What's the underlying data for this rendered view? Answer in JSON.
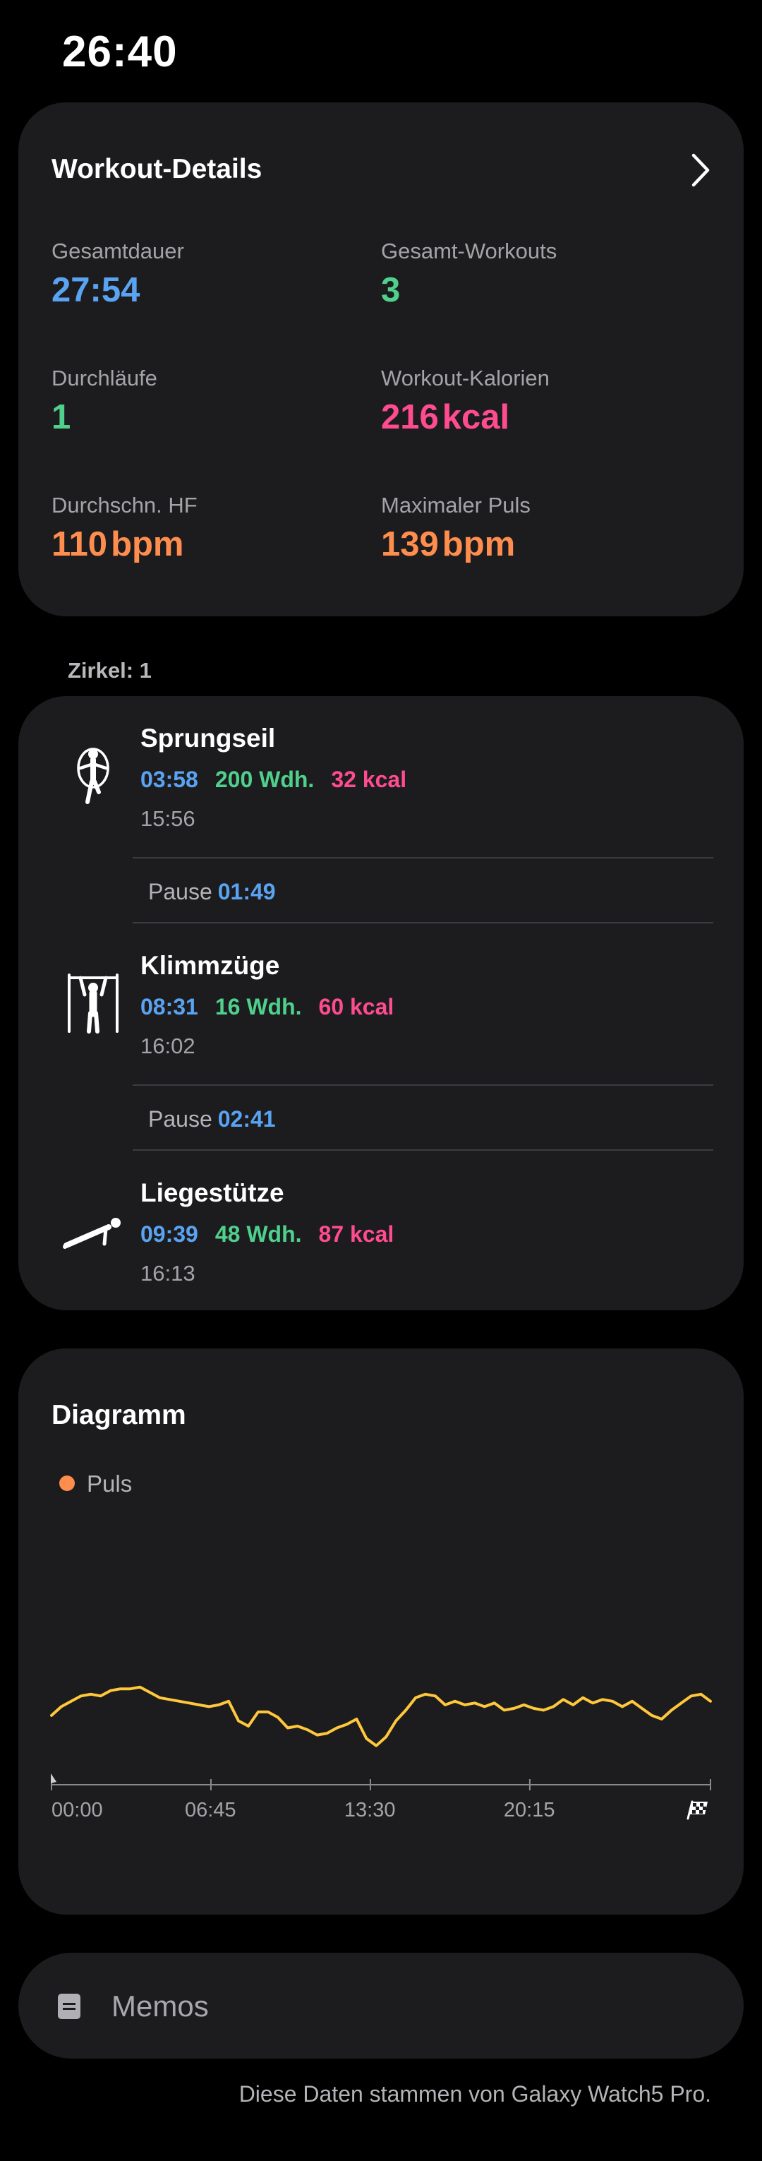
{
  "status_bar": {
    "time": "26:40"
  },
  "workout_details": {
    "title": "Workout-Details",
    "total_duration": {
      "label": "Gesamtdauer",
      "value": "27:54"
    },
    "total_workouts": {
      "label": "Gesamt-Workouts",
      "value": "3"
    },
    "rounds": {
      "label": "Durchläufe",
      "value": "1"
    },
    "calories": {
      "label": "Workout-Kalorien",
      "value": "216",
      "unit": "kcal"
    },
    "avg_hr": {
      "label": "Durchschn. HF",
      "value": "110",
      "unit": "bpm"
    },
    "max_hr": {
      "label": "Maximaler Puls",
      "value": "139",
      "unit": "bpm"
    }
  },
  "circuit": {
    "label": "Zirkel: 1",
    "exercises": [
      {
        "name": "Sprungseil",
        "duration": "03:58",
        "reps": "200 Wdh.",
        "kcal": "32 kcal",
        "start": "15:56",
        "icon": "jump-rope-icon"
      },
      {
        "name": "Klimmzüge",
        "duration": "08:31",
        "reps": "16 Wdh.",
        "kcal": "60 kcal",
        "start": "16:02",
        "icon": "pull-up-icon"
      },
      {
        "name": "Liegestütze",
        "duration": "09:39",
        "reps": "48 Wdh.",
        "kcal": "87 kcal",
        "start": "16:13",
        "icon": "push-up-icon"
      }
    ],
    "pauses": [
      {
        "label": "Pause",
        "value": "01:49"
      },
      {
        "label": "Pause",
        "value": "02:41"
      }
    ]
  },
  "diagram": {
    "title": "Diagramm",
    "legend": "Puls",
    "finish_icon": "finish-flag-icon"
  },
  "chart_data": {
    "type": "line",
    "title": "Diagramm",
    "x_unit": "mm:ss",
    "x_ticks": [
      "00:00",
      "06:45",
      "13:30",
      "20:15"
    ],
    "xlim": [
      "00:00",
      "27:54"
    ],
    "ylim": [
      70,
      140
    ],
    "series": [
      {
        "name": "Puls",
        "x": [
          "00:00",
          "00:25",
          "00:50",
          "01:15",
          "01:40",
          "02:05",
          "02:30",
          "02:55",
          "03:20",
          "03:45",
          "04:10",
          "04:35",
          "05:00",
          "05:25",
          "05:50",
          "06:15",
          "06:40",
          "07:05",
          "07:30",
          "07:55",
          "08:20",
          "08:45",
          "09:10",
          "09:35",
          "10:00",
          "10:25",
          "10:50",
          "11:15",
          "11:40",
          "12:05",
          "12:30",
          "12:55",
          "13:20",
          "13:45",
          "14:10",
          "14:35",
          "15:00",
          "15:25",
          "15:50",
          "16:15",
          "16:40",
          "17:05",
          "17:30",
          "17:55",
          "18:20",
          "18:45",
          "19:10",
          "19:35",
          "20:00",
          "20:25",
          "20:50",
          "21:15",
          "21:40",
          "22:05",
          "22:30",
          "22:55",
          "23:20",
          "23:45",
          "24:10",
          "24:35",
          "25:00",
          "25:25",
          "25:50",
          "26:15",
          "26:40",
          "27:05",
          "27:30",
          "27:54"
        ],
        "y": [
          109,
          114,
          117,
          120,
          121,
          120,
          123,
          124,
          124,
          125,
          122,
          119,
          118,
          117,
          116,
          115,
          114,
          115,
          117,
          106,
          103,
          111,
          111,
          108,
          102,
          103,
          101,
          98,
          99,
          102,
          104,
          107,
          96,
          92,
          97,
          106,
          112,
          119,
          121,
          120,
          115,
          117,
          115,
          116,
          114,
          116,
          112,
          113,
          115,
          113,
          112,
          114,
          118,
          115,
          119,
          116,
          118,
          117,
          114,
          117,
          113,
          109,
          107,
          112,
          116,
          120,
          121,
          117
        ]
      }
    ]
  },
  "memos": {
    "label": "Memos"
  },
  "footer": {
    "source": "Diese Daten stammen von Galaxy Watch5 Pro."
  }
}
